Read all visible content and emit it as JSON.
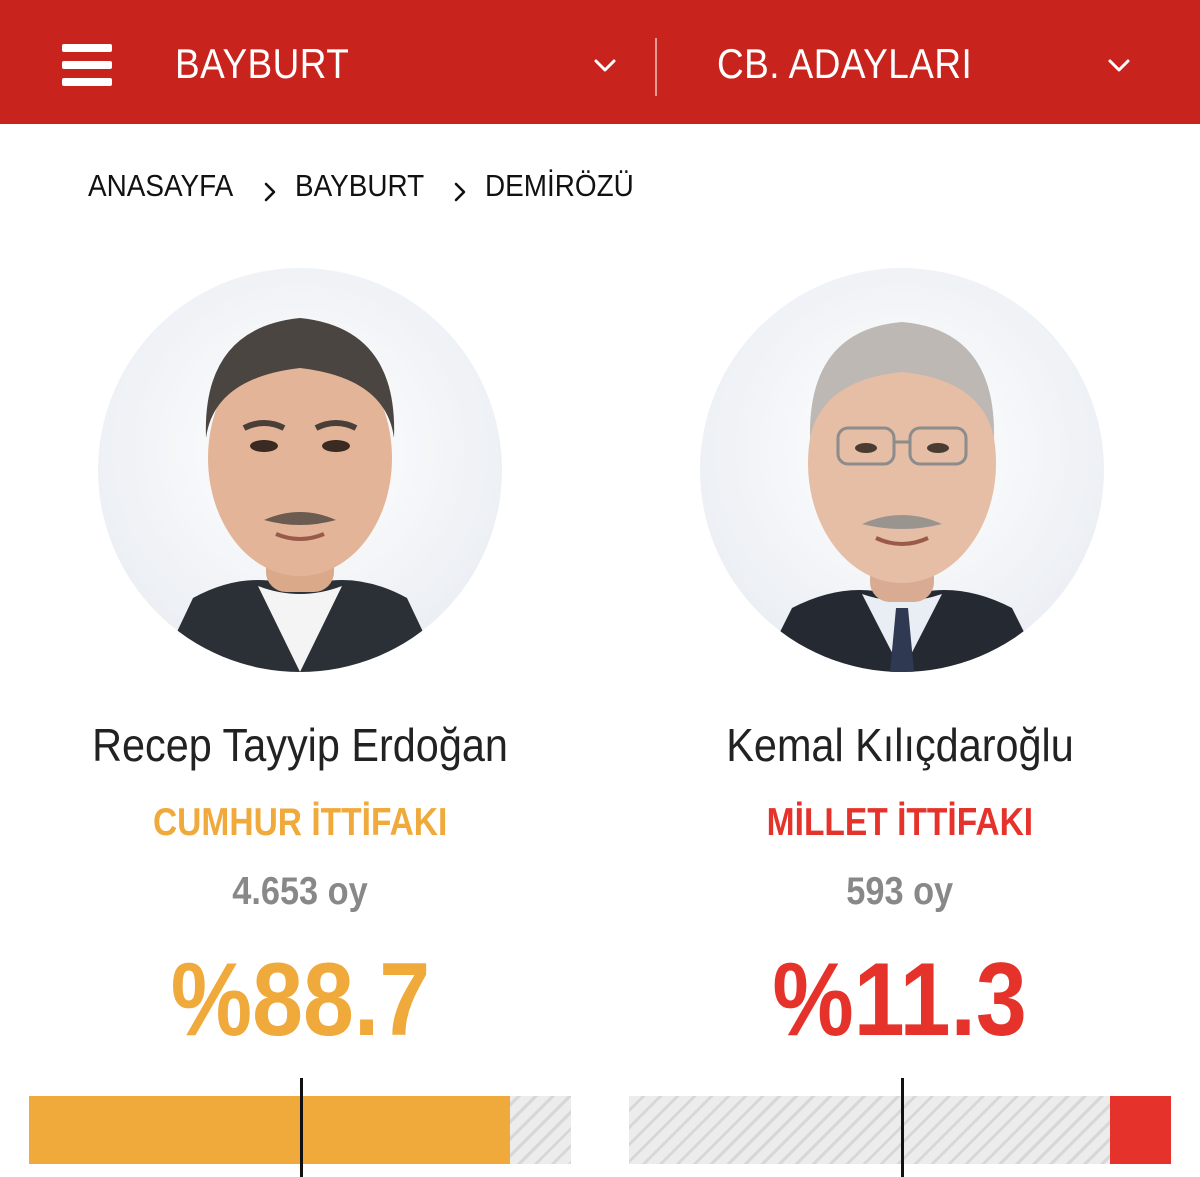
{
  "header": {
    "province": "BAYBURT",
    "election_type": "CB. ADAYLARI",
    "accent": "#c8231d"
  },
  "breadcrumb": [
    "ANASAYFA",
    "BAYBURT",
    "DEMİRÖZÜ"
  ],
  "candidates": [
    {
      "name": "Recep Tayyip Erdoğan",
      "alliance": "CUMHUR İTTİFAKI",
      "votes": "4.653 oy",
      "percent_label": "%88.7",
      "share": 88.7,
      "color": "#f0a93b"
    },
    {
      "name": "Kemal Kılıçdaroğlu",
      "alliance": "MİLLET İTTİFAKI",
      "votes": "593 oy",
      "percent_label": "%11.3",
      "share": 11.3,
      "color": "#e5322b"
    }
  ],
  "icons": {
    "menu": "hamburger-icon",
    "dropdown": "chevron-down-icon",
    "separator": "chevron-right-icon"
  }
}
